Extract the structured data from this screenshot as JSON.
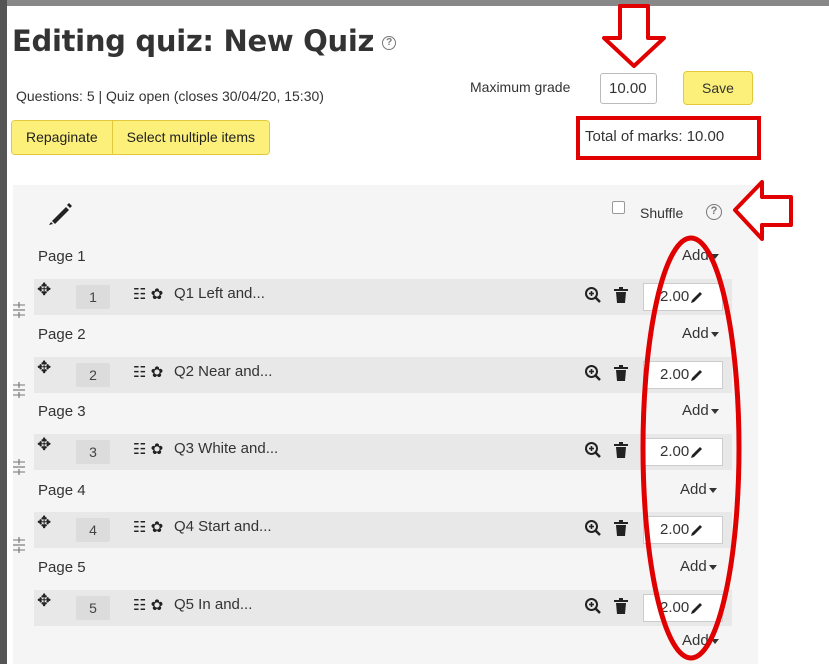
{
  "header": {
    "title": "Editing quiz: New Quiz",
    "info": "Questions: 5 | Quiz open (closes 30/04/20, 15:30)"
  },
  "toolbar": {
    "repaginate_label": "Repaginate",
    "select_multiple_label": "Select multiple items",
    "max_grade_label": "Maximum grade",
    "max_grade_value": "10.00",
    "save_label": "Save",
    "total_marks": "Total of marks: 10.00"
  },
  "section": {
    "shuffle_label": "Shuffle",
    "shuffle_checked": false
  },
  "add_label": "Add",
  "pages": [
    {
      "label": "Page 1",
      "question": {
        "number": "1",
        "name": "Q1 Left and...",
        "mark": "2.00"
      }
    },
    {
      "label": "Page 2",
      "question": {
        "number": "2",
        "name": "Q2 Near and...",
        "mark": "2.00"
      }
    },
    {
      "label": "Page 3",
      "question": {
        "number": "3",
        "name": "Q3 White and...",
        "mark": "2.00"
      }
    },
    {
      "label": "Page 4",
      "question": {
        "number": "4",
        "name": "Q4 Start and...",
        "mark": "2.00"
      }
    },
    {
      "label": "Page 5",
      "question": {
        "number": "5",
        "name": "Q5 In and...",
        "mark": "2.00"
      }
    }
  ],
  "colors": {
    "button_yellow": "#fcf07b",
    "annotation_red": "#e00000",
    "panel_bg": "#f5f5f5",
    "row_bg": "#e8e8e8"
  },
  "icons": [
    "help-icon",
    "pencil-icon",
    "move-icon",
    "question-type-icon",
    "gear-icon",
    "preview-icon",
    "delete-icon",
    "repaginate-icon"
  ]
}
